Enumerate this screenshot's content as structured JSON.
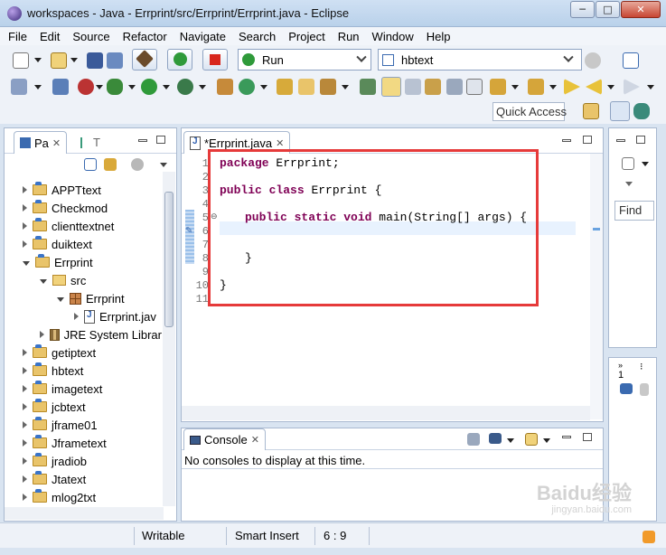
{
  "window": {
    "title": "workspaces - Java - Errprint/src/Errprint/Errprint.java - Eclipse",
    "minimize": "─",
    "maximize": "□",
    "close": "✕"
  },
  "menu": [
    "File",
    "Edit",
    "Source",
    "Refactor",
    "Navigate",
    "Search",
    "Project",
    "Run",
    "Window",
    "Help"
  ],
  "toolbar": {
    "run_config": "Run",
    "project_combo": "hbtext",
    "quick_access": "Quick Access"
  },
  "package_explorer": {
    "tab_label": "Pa",
    "tab2_label": "T",
    "items": [
      {
        "label": "APPTtext",
        "type": "project",
        "level": 0,
        "expanded": false
      },
      {
        "label": "Checkmod",
        "type": "project",
        "level": 0,
        "expanded": false
      },
      {
        "label": "clienttextnet",
        "type": "project",
        "level": 0,
        "expanded": false
      },
      {
        "label": "duiktext",
        "type": "project",
        "level": 0,
        "expanded": false
      },
      {
        "label": "Errprint",
        "type": "project",
        "level": 0,
        "expanded": true
      },
      {
        "label": "src",
        "type": "src",
        "level": 1,
        "expanded": true
      },
      {
        "label": "Errprint",
        "type": "package",
        "level": 2,
        "expanded": true
      },
      {
        "label": "Errprint.jav",
        "type": "java",
        "level": 3,
        "expanded": false
      },
      {
        "label": "JRE System Librar",
        "type": "jre",
        "level": 1,
        "expanded": false
      },
      {
        "label": "getiptext",
        "type": "project",
        "level": 0,
        "expanded": false
      },
      {
        "label": "hbtext",
        "type": "project",
        "level": 0,
        "expanded": false
      },
      {
        "label": "imagetext",
        "type": "project",
        "level": 0,
        "expanded": false
      },
      {
        "label": "jcbtext",
        "type": "project",
        "level": 0,
        "expanded": false
      },
      {
        "label": "jframe01",
        "type": "project",
        "level": 0,
        "expanded": false
      },
      {
        "label": "Jframetext",
        "type": "project",
        "level": 0,
        "expanded": false
      },
      {
        "label": "jradiob",
        "type": "project",
        "level": 0,
        "expanded": false
      },
      {
        "label": "Jtatext",
        "type": "project",
        "level": 0,
        "expanded": false
      },
      {
        "label": "mlog2txt",
        "type": "project",
        "level": 0,
        "expanded": false
      }
    ]
  },
  "editor": {
    "tab_label": "*Errprint.java",
    "line_numbers": [
      "1",
      "2",
      "3",
      "4",
      "5",
      "6",
      "7",
      "8",
      "9",
      "10",
      "11"
    ],
    "code": {
      "l1_kw": "package",
      "l1_rest": " Errprint;",
      "l3_kw1": "public",
      "l3_kw2": "class",
      "l3_rest": " Errprint {",
      "l5_kw1": "public",
      "l5_kw2": "static",
      "l5_kw3": "void",
      "l5_rest": " main(String[] args) {",
      "l8": "}",
      "l10": "}"
    }
  },
  "console": {
    "tab_label": "Console",
    "message": "No consoles to display at this time."
  },
  "right_panel": {
    "find_label": "Find",
    "task_count": "1"
  },
  "status_bar": {
    "writable": "Writable",
    "insert_mode": "Smart Insert",
    "position": "6 : 9"
  },
  "watermark": {
    "logo": "Baidu经验",
    "url": "jingyan.baidu.com"
  }
}
